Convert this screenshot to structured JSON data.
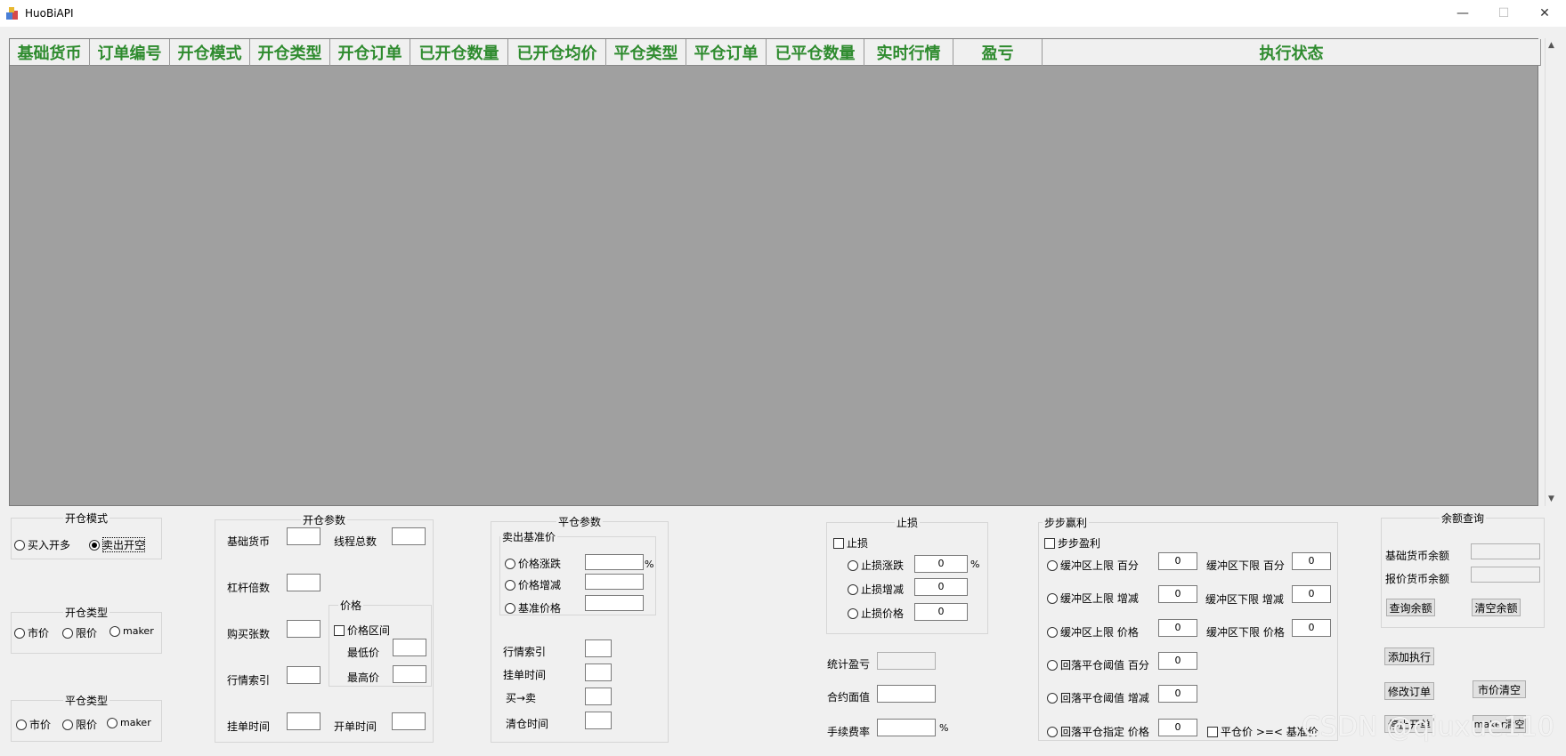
{
  "window": {
    "title": "HuoBiAPI",
    "min": "—",
    "max": "☐",
    "close": "✕"
  },
  "grid": {
    "columns": [
      "基础货币",
      "订单编号",
      "开仓模式",
      "开仓类型",
      "开仓订单",
      "已开仓数量",
      "已开仓均价",
      "平仓类型",
      "平仓订单",
      "已平仓数量",
      "实时行情",
      "盈亏",
      "执行状态"
    ],
    "scroll_up": "▲",
    "scroll_down": "▼"
  },
  "open_mode": {
    "title": "开仓模式",
    "buy_long": "买入开多",
    "sell_short": "卖出开空"
  },
  "open_type": {
    "title": "开仓类型",
    "market": "市价",
    "limit": "限价",
    "maker": "maker"
  },
  "close_type": {
    "title": "平仓类型",
    "market": "市价",
    "limit": "限价",
    "maker": "maker"
  },
  "open_params": {
    "title": "开仓参数",
    "base_currency": "基础货币",
    "thread_total": "线程总数",
    "leverage": "杠杆倍数",
    "buy_count": "购买张数",
    "market_index": "行情索引",
    "order_time": "挂单时间",
    "open_time": "开单时间",
    "price_group": {
      "title": "价格",
      "range": "价格区间",
      "min": "最低价",
      "max": "最高价"
    }
  },
  "close_params": {
    "title": "平仓参数",
    "sell_ref_title": "卖出基准价",
    "price_pct": "价格涨跌",
    "pct_unit": "%",
    "price_delta": "价格增减",
    "base_price": "基准价格",
    "market_index": "行情索引",
    "order_time": "挂单时间",
    "buy_sell": "买→卖",
    "clear_time": "清仓时间"
  },
  "stop_loss": {
    "title": "止损",
    "enable": "止损",
    "pct": {
      "label": "止损涨跌",
      "value": "0",
      "unit": "%"
    },
    "delta": {
      "label": "止损增减",
      "value": "0"
    },
    "price": {
      "label": "止损价格",
      "value": "0"
    }
  },
  "stats": {
    "pnl": "统计盈亏",
    "face_value": "合约面值",
    "fee_rate": "手续费率",
    "fee_unit": "%"
  },
  "step_profit": {
    "title": "步步赢利",
    "enable": "步步盈利",
    "upper_pct": {
      "label": "缓冲区上限 百分",
      "value": "0"
    },
    "lower_pct": {
      "label": "缓冲区下限 百分",
      "value": "0"
    },
    "upper_delta": {
      "label": "缓冲区上限 增减",
      "value": "0"
    },
    "lower_delta": {
      "label": "缓冲区下限 增减",
      "value": "0"
    },
    "upper_price": {
      "label": "缓冲区上限 价格",
      "value": "0"
    },
    "lower_price": {
      "label": "缓冲区下限 价格",
      "value": "0"
    },
    "drop_pct": {
      "label": "回落平仓阈值 百分",
      "value": "0"
    },
    "drop_delta": {
      "label": "回落平仓阈值 增减",
      "value": "0"
    },
    "drop_price": {
      "label": "回落平仓指定 价格",
      "value": "0"
    },
    "close_check": "平仓价 >=< 基准价"
  },
  "balance": {
    "title": "余额查询",
    "base_balance": "基础货币余额",
    "quote_balance": "报价货币余额",
    "query_btn": "查询余额",
    "clear_btn": "清空余额"
  },
  "actions": {
    "add": "添加执行",
    "modify": "修改订单",
    "market_clear": "市价清空",
    "stop_open": "停止开单",
    "maker_clear": "maker清空"
  },
  "watermark": "CSDN @qiuxue110"
}
